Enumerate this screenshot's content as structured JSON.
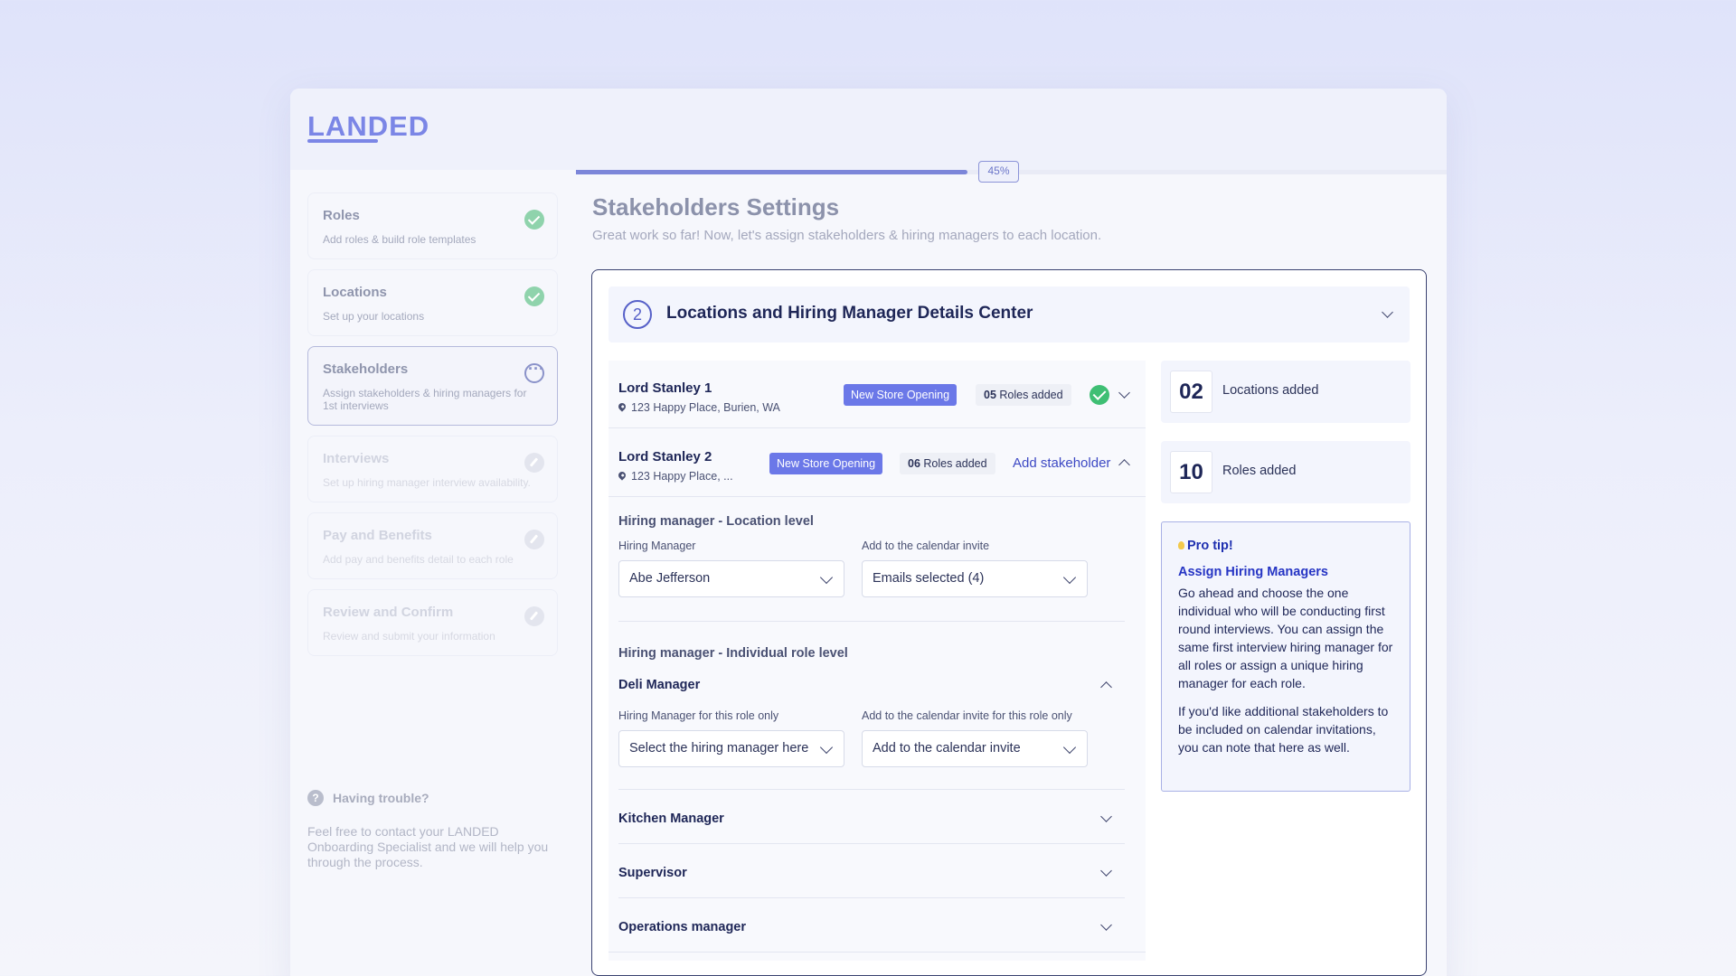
{
  "app": {
    "logo": "LANDED"
  },
  "progress": {
    "percent": 45,
    "label": "45%"
  },
  "sidebar": {
    "steps": [
      {
        "title": "Roles",
        "subtitle": "Add roles & build role templates",
        "status": "complete"
      },
      {
        "title": "Locations",
        "subtitle": "Set up your locations",
        "status": "complete"
      },
      {
        "title": "Stakeholders",
        "subtitle": "Assign stakeholders & hiring managers for 1st interviews",
        "status": "in-progress"
      },
      {
        "title": "Interviews",
        "subtitle": "Set up hiring manager interview availability.",
        "status": "pending"
      },
      {
        "title": "Pay and Benefits",
        "subtitle": "Add pay and benefits detail to each role",
        "status": "pending"
      },
      {
        "title": "Review and Confirm",
        "subtitle": "Review and submit your information",
        "status": "pending"
      }
    ],
    "help": {
      "icon": "?",
      "title": "Having trouble?",
      "text": "Feel free to contact your LANDED Onboarding Specialist and we will help you through the process."
    }
  },
  "page": {
    "title": "Stakeholders Settings",
    "subtitle": "Great work so far! Now, let's assign stakeholders & hiring managers to each location."
  },
  "card": {
    "step_number": "2",
    "title": "Locations and Hiring Manager Details Center"
  },
  "locations": [
    {
      "name": "Lord Stanley 1",
      "address": "123 Happy Place, Burien, WA",
      "tag": "New Store Opening",
      "roles_count": "05",
      "roles_suffix": " Roles added"
    },
    {
      "name": "Lord Stanley 2",
      "address": "123 Happy Place, ...",
      "tag": "New Store Opening",
      "roles_count": "06",
      "roles_suffix": " Roles added",
      "action": "Add stakeholder"
    }
  ],
  "location_level": {
    "title": "Hiring manager - Location level",
    "hiring_manager_label": "Hiring Manager",
    "hiring_manager_value": "Abe Jefferson",
    "calendar_label": "Add to the calendar invite",
    "calendar_value": "Emails selected (4)"
  },
  "role_level": {
    "title": "Hiring manager - Individual role level",
    "expanded_role": "Deli Manager",
    "hm_label": "Hiring Manager for this role only",
    "hm_placeholder": "Select the hiring manager here",
    "cal_label": "Add to the calendar invite for this role only",
    "cal_placeholder": "Add to the calendar invite",
    "collapsed_roles": [
      "Kitchen Manager",
      "Supervisor",
      "Operations manager"
    ]
  },
  "stats": [
    {
      "value": "02",
      "label": "Locations added"
    },
    {
      "value": "10",
      "label": "Roles added"
    }
  ],
  "tip": {
    "heading": "Pro tip!",
    "subheading": "Assign Hiring Managers",
    "paragraph1": "Go ahead and choose the one individual who will be conducting first round interviews. You can assign the same first interview hiring manager for all roles or assign a unique hiring manager for each role.",
    "paragraph2": "If you'd like additional stakeholders to be included on calendar invitations, you can note that here as well."
  },
  "colors": {
    "accent": "#6b78e8",
    "brand": "#7b86e6",
    "success": "#3fbf74",
    "text_dark": "#1e2657"
  }
}
